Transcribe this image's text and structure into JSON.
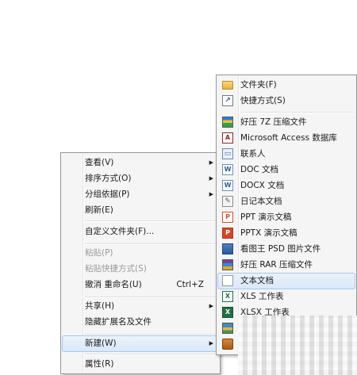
{
  "context_menu": {
    "items": [
      {
        "label": "查看(V)",
        "submenu": true
      },
      {
        "label": "排序方式(O)",
        "submenu": true
      },
      {
        "label": "分组依据(P)",
        "submenu": true
      },
      {
        "label": "刷新(E)"
      },
      {
        "label": "自定义文件夹(F)..."
      },
      {
        "label": "粘贴(P)",
        "disabled": true
      },
      {
        "label": "粘贴快捷方式(S)",
        "disabled": true
      },
      {
        "label": "撤消 重命名(U)",
        "accel": "Ctrl+Z"
      },
      {
        "label": "共享(H)",
        "submenu": true
      },
      {
        "label": "隐藏扩展名及文件"
      },
      {
        "label": "新建(W)",
        "submenu": true,
        "highlighted": true
      },
      {
        "label": "属性(R)"
      }
    ]
  },
  "new_submenu": {
    "items": [
      {
        "label": "文件夹(F)",
        "icon": "folder-icon"
      },
      {
        "label": "快捷方式(S)",
        "icon": "shortcut-icon"
      },
      {
        "label": "好压 7Z 压缩文件",
        "icon": "7z-archive-icon"
      },
      {
        "label": "Microsoft Access 数据库",
        "icon": "access-database-icon",
        "glyph": "A"
      },
      {
        "label": "联系人",
        "icon": "contact-icon"
      },
      {
        "label": "DOC 文档",
        "icon": "doc-icon",
        "glyph": "W"
      },
      {
        "label": "DOCX 文档",
        "icon": "docx-icon",
        "glyph": "W"
      },
      {
        "label": "日记本文档",
        "icon": "journal-icon"
      },
      {
        "label": "PPT 演示文稿",
        "icon": "ppt-icon",
        "glyph": "P"
      },
      {
        "label": "PPTX 演示文稿",
        "icon": "pptx-icon",
        "glyph": "P"
      },
      {
        "label": "看图王 PSD 图片文件",
        "icon": "psd-image-icon"
      },
      {
        "label": "好压 RAR 压缩文件",
        "icon": "rar-archive-icon"
      },
      {
        "label": "文本文档",
        "icon": "text-document-icon",
        "highlighted": true
      },
      {
        "label": "XLS 工作表",
        "icon": "xls-icon",
        "glyph": "X"
      },
      {
        "label": "XLSX 工作表",
        "icon": "xlsx-icon",
        "glyph": "X"
      },
      {
        "label": "",
        "icon": "image-file-icon"
      },
      {
        "label": "",
        "icon": "package-icon"
      }
    ]
  }
}
